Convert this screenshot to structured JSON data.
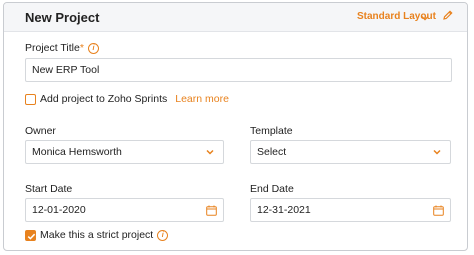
{
  "header": {
    "title": "New Project",
    "layout_label": "Standard Layout"
  },
  "project_title": {
    "label": "Project Title",
    "required_mark": "*",
    "value": "New ERP Tool"
  },
  "sprints": {
    "label": "Add project to Zoho Sprints",
    "link": "Learn more",
    "checked": false
  },
  "owner": {
    "label": "Owner",
    "value": "Monica Hemsworth"
  },
  "template": {
    "label": "Template",
    "value": "Select"
  },
  "start_date": {
    "label": "Start Date",
    "value": "12-01-2020"
  },
  "end_date": {
    "label": "End Date",
    "value": "12-31-2021"
  },
  "strict": {
    "label": "Make this a strict project",
    "checked": true
  },
  "colors": {
    "accent": "#e8821e",
    "header_bg": "#f5f6f8",
    "border": "#d5d8dc"
  },
  "icons": {
    "info": "info-icon",
    "edit": "pencil-icon",
    "dropdown": "chevron-down-icon",
    "calendar": "calendar-icon"
  }
}
